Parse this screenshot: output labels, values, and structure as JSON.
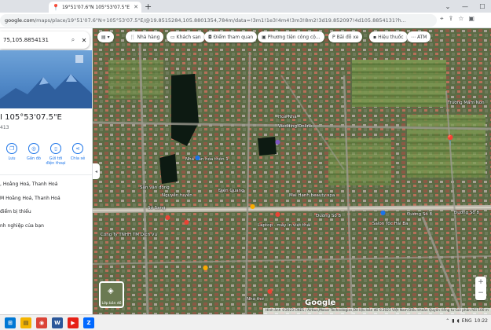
{
  "browser": {
    "tab_title": "19°51'07.6\"N 105°53'07.5\"E - Go",
    "url_domain": "google.com",
    "url_path": "/maps/place/19°51'07.6\"N+105°53'07.5\"E/@19.8515284,105.8801354,784m/data=!3m1!1e3!4m4!3m3!8m2!3d19.852097!4d105.8854131?h..."
  },
  "panel": {
    "search_value": "75,105.8854131",
    "coord_title": "I 105°53'07.5\"E",
    "coord_sub": "413",
    "actions": [
      {
        "label": "Lưu",
        "icon": "bookmark-icon"
      },
      {
        "label": "Gần đó",
        "icon": "nearby-icon"
      },
      {
        "label": "Gửi tới điện thoại",
        "icon": "phone-icon"
      },
      {
        "label": "Chia sẻ",
        "icon": "share-icon"
      }
    ],
    "info_rows": [
      ", Hoằng Hoá, Thanh Hoá",
      "M Hoằng Hoá, Thanh Hoá",
      "điểm bị thiếu",
      "nh nghiệp của bạn"
    ]
  },
  "map": {
    "chips": [
      {
        "label": "",
        "icon": "toolbox-icon"
      },
      {
        "label": "Nhà hàng",
        "icon": "restaurant-icon"
      },
      {
        "label": "Khách sạn",
        "icon": "hotel-icon"
      },
      {
        "label": "Điểm tham quan",
        "icon": "camera-icon"
      },
      {
        "label": "Phương tiện công cộ...",
        "icon": "transit-icon"
      },
      {
        "label": "Bãi đỗ xe",
        "icon": "parking-icon"
      },
      {
        "label": "Hiệu thuốc",
        "icon": "pharmacy-icon"
      },
      {
        "label": "ATM",
        "icon": "atm-icon"
      }
    ],
    "labels": [
      "Nhà Văn hóa thôn 1",
      "Hoà Nhà",
      "Wedding Online",
      "Sở Sang",
      "Sân vận động",
      "Nguyễn tuyển",
      "Điện Quang",
      "Mai Hạnh beauty spa",
      "Đường Số 8",
      "Đường Số 8",
      "Đường Số 8",
      "Salon Tóc Hải Ba",
      "Công Ty TNHH TM Dịch Vụ",
      "Laptop - máy in việt thái",
      "Nhà thờ",
      "Trường Mầm Non"
    ],
    "layers_label": "Lớp bản đồ",
    "logo": "Google",
    "attribution": "Hình ảnh ©2023 CNES / Airbus,Maxar Technologies,Dữ liệu bản đồ ©2023   Việt Nam   Điều khoản   Quyền riêng tư   Gửi phản hồi   100 m"
  },
  "taskbar": {
    "apps": [
      {
        "name": "windows-icon",
        "label": "⊞"
      },
      {
        "name": "explorer-icon",
        "label": "▤"
      },
      {
        "name": "chrome-icon",
        "label": "◉"
      },
      {
        "name": "word-icon",
        "label": "W"
      },
      {
        "name": "youtube-icon",
        "label": "▶"
      },
      {
        "name": "zalo-icon",
        "label": "Z"
      }
    ],
    "lang": "ENG",
    "time": "10:22"
  }
}
